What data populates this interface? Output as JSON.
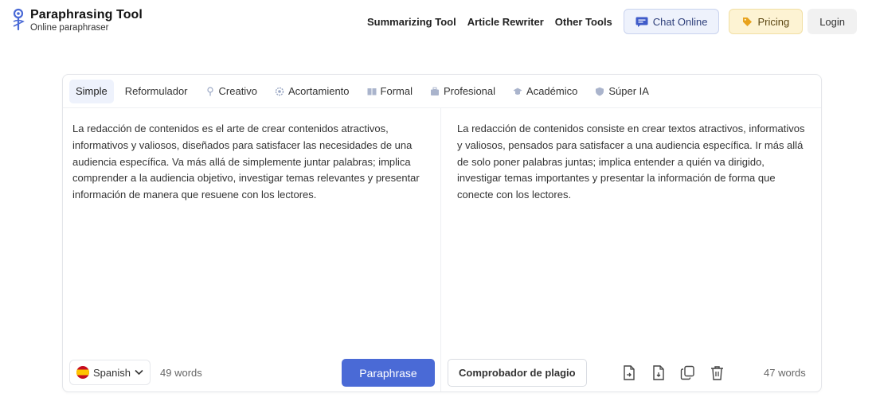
{
  "header": {
    "logo_title": "Paraphrasing Tool",
    "logo_subtitle": "Online paraphraser",
    "nav": [
      "Summarizing Tool",
      "Article Rewriter",
      "Other Tools"
    ],
    "chat_label": "Chat Online",
    "pricing_label": "Pricing",
    "login_label": "Login"
  },
  "modes": [
    {
      "label": "Simple",
      "icon": "none",
      "active": true
    },
    {
      "label": "Reformulador",
      "icon": "none"
    },
    {
      "label": "Creativo",
      "icon": "pin-icon"
    },
    {
      "label": "Acortamiento",
      "icon": "gear-icon"
    },
    {
      "label": "Formal",
      "icon": "book-icon"
    },
    {
      "label": "Profesional",
      "icon": "briefcase-icon"
    },
    {
      "label": "Académico",
      "icon": "graduation-cap-icon"
    },
    {
      "label": "Súper IA",
      "icon": "shield-icon"
    }
  ],
  "input": {
    "text": "La redacción de contenidos es el arte de crear contenidos atractivos, informativos y valiosos, diseñados para satisfacer las necesidades de una audiencia específica. Va más allá de simplemente juntar palabras; implica comprender a la audiencia objetivo, investigar temas relevantes y presentar información de manera que resuene con los lectores.",
    "language": "Spanish",
    "word_count": "49 words",
    "paraphrase_label": "Paraphrase"
  },
  "output": {
    "text": "La redacción de contenidos consiste en crear textos atractivos, informativos y valiosos, pensados para satisfacer a una audiencia específica. Ir más allá de solo poner palabras juntas; implica entender a quién va dirigido, investigar temas importantes y presentar la información de forma que conecte con los lectores.",
    "plagiarism_label": "Comprobador de plagio",
    "word_count": "47 words"
  },
  "colors": {
    "accent": "#4a6ad6",
    "chat_bg": "#eef2fc",
    "pricing_bg": "#fdf3d3"
  }
}
